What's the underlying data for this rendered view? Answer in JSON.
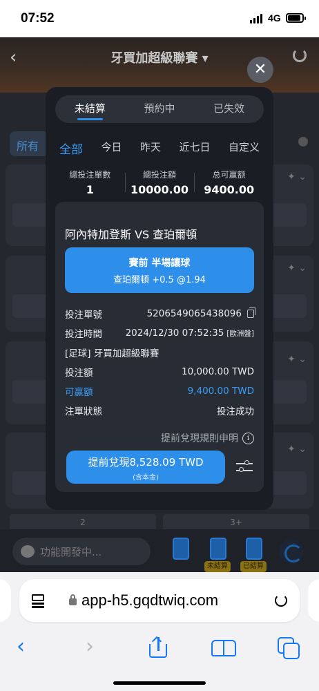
{
  "status_bar": {
    "time": "07:52",
    "network": "4G"
  },
  "app": {
    "league_title": "牙買加超級聯賽 ▾",
    "filter_label": "所有",
    "bg_bottom_tabs": [
      "2",
      "3+"
    ],
    "chat_placeholder": "功能開發中...",
    "footer_badges": [
      "未結算",
      "已結算"
    ]
  },
  "modal": {
    "close_glyph": "✕",
    "tabs": [
      "未結算",
      "預約中",
      "已失效"
    ],
    "periods": [
      "全部",
      "今日",
      "昨天",
      "近七日",
      "自定义"
    ],
    "stats": [
      {
        "label": "總投注單數",
        "value": "1"
      },
      {
        "label": "總投注額",
        "value": "10000.00"
      },
      {
        "label": "总可赢额",
        "value": "9400.00"
      }
    ],
    "ticket": {
      "match": "阿內特加登斯  VS  查珀爾頓",
      "bet_line1": "賽前   半場讓球",
      "bet_line2": "查珀爾頓 +0.5 @1.94",
      "rows": [
        {
          "label": "投注單號",
          "value": "5206549065438096",
          "extra": ""
        },
        {
          "label": "投注時間",
          "value": "2024/12/30 07:52:35",
          "extra": "[歐洲盤]"
        },
        {
          "label": "[足球] 牙買加超級聯賽",
          "value": "",
          "extra": ""
        },
        {
          "label": "投注額",
          "value": "10,000.00 TWD",
          "extra": ""
        },
        {
          "label": "可贏額",
          "value": "9,400.00 TWD",
          "extra": ""
        },
        {
          "label": "注單狀態",
          "value": "投注成功",
          "extra": ""
        }
      ],
      "rules_link": "提前兌現規則申明",
      "cashout_label": "提前兌現8,528.09 TWD",
      "cashout_sub": "(含本金)"
    }
  },
  "browser": {
    "url": "app-h5.gqdtwiq.com"
  },
  "colors": {
    "accent": "#2e8fea",
    "modal_bg": "#1a1d24",
    "ticket_bg": "#282c35",
    "safari_blue": "#1477f8"
  }
}
